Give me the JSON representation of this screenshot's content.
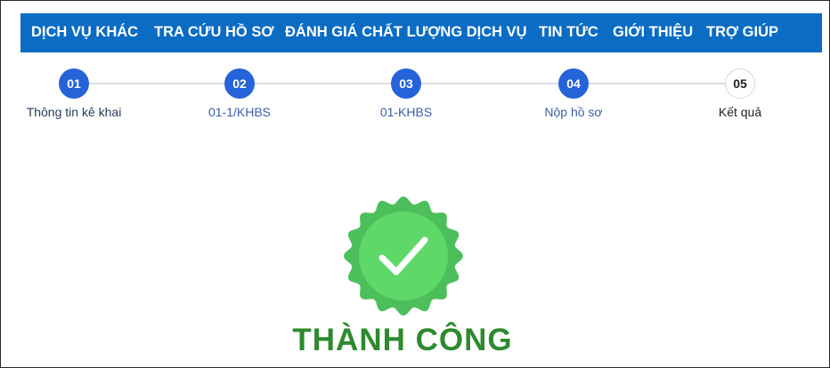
{
  "nav": {
    "items": [
      {
        "label": "DỊCH VỤ KHÁC"
      },
      {
        "label": "TRA CỨU HỒ SƠ"
      },
      {
        "label": "ĐÁNH GIÁ CHẤT LƯỢNG DỊCH VỤ"
      },
      {
        "label": "TIN TỨC"
      },
      {
        "label": "GIỚI THIỆU"
      },
      {
        "label": "TRỢ GIÚP"
      }
    ]
  },
  "steps": [
    {
      "number": "01",
      "label": "Thông tin kê khai",
      "status": "done"
    },
    {
      "number": "02",
      "label": "01-1/KHBS",
      "status": "done"
    },
    {
      "number": "03",
      "label": "01-KHBS",
      "status": "done"
    },
    {
      "number": "04",
      "label": "Nộp hồ sơ",
      "status": "done"
    },
    {
      "number": "05",
      "label": "Kết quả",
      "status": "current"
    }
  ],
  "result": {
    "icon": "check-badge-icon",
    "title": "THÀNH CÔNG"
  },
  "colors": {
    "nav_bg": "#0b6cc4",
    "step_active": "#2563d9",
    "badge_outer": "#4cbf5a",
    "badge_inner": "#5fd86a",
    "success_text": "#2e8a2e"
  }
}
